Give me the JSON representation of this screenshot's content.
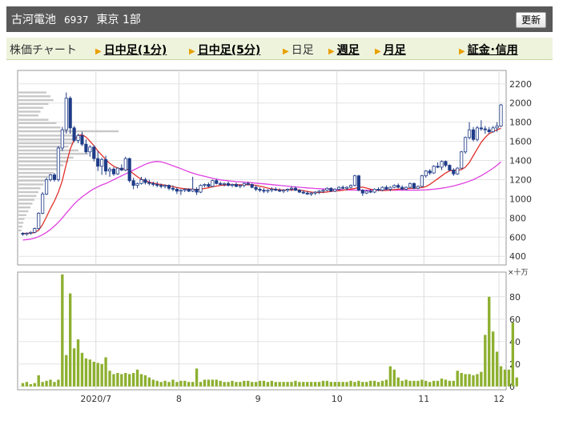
{
  "header": {
    "company": "古河電池",
    "code": "6937",
    "market": "東京 1部",
    "update_label": "更新"
  },
  "tabs": [
    {
      "label": "株価チャート",
      "kind": "static"
    },
    {
      "label": "日中足(1分)",
      "kind": "link"
    },
    {
      "label": "日中足(5分)",
      "kind": "link"
    },
    {
      "label": "日足",
      "kind": "plain"
    },
    {
      "label": "週足",
      "kind": "link"
    },
    {
      "label": "月足",
      "kind": "link"
    },
    {
      "label": "証金･信用",
      "kind": "link"
    }
  ],
  "chart_data": {
    "type": "candlestick",
    "period": "daily",
    "price_axis": {
      "ticks": [
        400,
        600,
        800,
        1000,
        1200,
        1400,
        1600,
        1800,
        2000,
        2200
      ],
      "range": [
        310,
        2340
      ]
    },
    "volume_axis": {
      "unit": "×十万",
      "ticks": [
        0,
        20,
        40,
        60,
        80
      ],
      "range": [
        -3,
        102
      ]
    },
    "x_labels": [
      {
        "label": "2020/7",
        "index": 19
      },
      {
        "label": "8",
        "index": 40
      },
      {
        "label": "9",
        "index": 60
      },
      {
        "label": "10",
        "index": 80
      },
      {
        "label": "11",
        "index": 102
      },
      {
        "label": "12",
        "index": 121
      }
    ],
    "colors": {
      "up": "#ffffff",
      "down": "#1f3c88",
      "ma_short": "#e0302a",
      "ma_long": "#e040e0",
      "volume": "#8db030",
      "profile": "#c8c8c8"
    },
    "volume_profile": [
      {
        "price": 1825,
        "value": 0.3
      },
      {
        "price": 1790,
        "value": 0.38
      },
      {
        "price": 1745,
        "value": 0.42
      },
      {
        "price": 1705,
        "value": 1.0
      },
      {
        "price": 1660,
        "value": 0.55
      },
      {
        "price": 1620,
        "value": 0.6
      },
      {
        "price": 1580,
        "value": 0.55
      },
      {
        "price": 1545,
        "value": 0.5
      },
      {
        "price": 1505,
        "value": 0.6
      },
      {
        "price": 1470,
        "value": 0.7
      },
      {
        "price": 1430,
        "value": 0.55
      },
      {
        "price": 1390,
        "value": 0.5
      },
      {
        "price": 1350,
        "value": 0.45
      },
      {
        "price": 1310,
        "value": 0.4
      },
      {
        "price": 1270,
        "value": 0.35
      },
      {
        "price": 1230,
        "value": 0.3
      },
      {
        "price": 1190,
        "value": 0.28
      },
      {
        "price": 1150,
        "value": 0.25
      },
      {
        "price": 1110,
        "value": 0.22
      },
      {
        "price": 1070,
        "value": 0.2
      },
      {
        "price": 1030,
        "value": 0.18
      },
      {
        "price": 990,
        "value": 0.16
      },
      {
        "price": 950,
        "value": 0.14
      },
      {
        "price": 910,
        "value": 0.12
      },
      {
        "price": 870,
        "value": 0.1
      },
      {
        "price": 830,
        "value": 0.08
      },
      {
        "price": 790,
        "value": 0.06
      },
      {
        "price": 750,
        "value": 0.05
      },
      {
        "price": 710,
        "value": 0.04
      },
      {
        "price": 670,
        "value": 0.03
      },
      {
        "price": 2110,
        "value": 0.28
      },
      {
        "price": 2070,
        "value": 0.32
      },
      {
        "price": 2030,
        "value": 0.35
      },
      {
        "price": 1990,
        "value": 0.3
      },
      {
        "price": 1950,
        "value": 0.25
      },
      {
        "price": 1910,
        "value": 0.22
      },
      {
        "price": 1870,
        "value": 0.2
      }
    ],
    "candles": [
      [
        640,
        650,
        615,
        630
      ],
      [
        630,
        650,
        615,
        640
      ],
      [
        640,
        660,
        625,
        650
      ],
      [
        650,
        700,
        640,
        690
      ],
      [
        690,
        860,
        680,
        850
      ],
      [
        850,
        1070,
        840,
        1050
      ],
      [
        1050,
        1220,
        1040,
        1200
      ],
      [
        1200,
        1260,
        1180,
        1250
      ],
      [
        1250,
        1270,
        1180,
        1200
      ],
      [
        1200,
        1550,
        1180,
        1530
      ],
      [
        1530,
        1750,
        1500,
        1720
      ],
      [
        1720,
        2110,
        1680,
        2050
      ],
      [
        2050,
        2070,
        1680,
        1740
      ],
      [
        1740,
        1760,
        1590,
        1610
      ],
      [
        1610,
        1680,
        1580,
        1660
      ],
      [
        1660,
        1700,
        1550,
        1570
      ],
      [
        1570,
        1620,
        1470,
        1490
      ],
      [
        1490,
        1560,
        1440,
        1540
      ],
      [
        1540,
        1560,
        1390,
        1420
      ],
      [
        1420,
        1500,
        1290,
        1340
      ],
      [
        1340,
        1430,
        1250,
        1410
      ],
      [
        1410,
        1450,
        1250,
        1290
      ],
      [
        1290,
        1330,
        1230,
        1310
      ],
      [
        1310,
        1330,
        1240,
        1260
      ],
      [
        1260,
        1330,
        1250,
        1320
      ],
      [
        1320,
        1360,
        1290,
        1300
      ],
      [
        1300,
        1440,
        1290,
        1420
      ],
      [
        1420,
        1430,
        1170,
        1190
      ],
      [
        1190,
        1220,
        1100,
        1140
      ],
      [
        1140,
        1170,
        1110,
        1160
      ],
      [
        1160,
        1230,
        1150,
        1200
      ],
      [
        1200,
        1220,
        1150,
        1170
      ],
      [
        1170,
        1200,
        1140,
        1160
      ],
      [
        1160,
        1180,
        1130,
        1150
      ],
      [
        1150,
        1180,
        1120,
        1140
      ],
      [
        1140,
        1160,
        1110,
        1130
      ],
      [
        1130,
        1150,
        1110,
        1140
      ],
      [
        1140,
        1150,
        1090,
        1110
      ],
      [
        1110,
        1140,
        1080,
        1100
      ],
      [
        1100,
        1120,
        1050,
        1080
      ],
      [
        1080,
        1100,
        1040,
        1090
      ],
      [
        1090,
        1110,
        1070,
        1100
      ],
      [
        1100,
        1110,
        1070,
        1080
      ],
      [
        1080,
        1230,
        1070,
        1100
      ],
      [
        1100,
        1120,
        1040,
        1070
      ],
      [
        1070,
        1150,
        1060,
        1140
      ],
      [
        1140,
        1160,
        1120,
        1150
      ],
      [
        1150,
        1170,
        1120,
        1130
      ],
      [
        1130,
        1200,
        1120,
        1190
      ],
      [
        1190,
        1210,
        1150,
        1160
      ],
      [
        1160,
        1180,
        1140,
        1150
      ],
      [
        1150,
        1170,
        1130,
        1160
      ],
      [
        1160,
        1180,
        1130,
        1140
      ],
      [
        1140,
        1160,
        1120,
        1150
      ],
      [
        1150,
        1170,
        1120,
        1130
      ],
      [
        1130,
        1150,
        1110,
        1140
      ],
      [
        1140,
        1170,
        1120,
        1160
      ],
      [
        1160,
        1180,
        1140,
        1150
      ],
      [
        1150,
        1160,
        1110,
        1120
      ],
      [
        1120,
        1140,
        1080,
        1100
      ],
      [
        1100,
        1120,
        1070,
        1090
      ],
      [
        1090,
        1110,
        1060,
        1080
      ],
      [
        1080,
        1100,
        1060,
        1090
      ],
      [
        1090,
        1120,
        1070,
        1100
      ],
      [
        1100,
        1120,
        1080,
        1090
      ],
      [
        1090,
        1110,
        1070,
        1080
      ],
      [
        1080,
        1100,
        1060,
        1090
      ],
      [
        1090,
        1110,
        1070,
        1100
      ],
      [
        1100,
        1130,
        1080,
        1110
      ],
      [
        1110,
        1130,
        1080,
        1090
      ],
      [
        1090,
        1100,
        1060,
        1070
      ],
      [
        1070,
        1090,
        1050,
        1060
      ],
      [
        1060,
        1080,
        1040,
        1050
      ],
      [
        1050,
        1070,
        1030,
        1060
      ],
      [
        1060,
        1080,
        1040,
        1070
      ],
      [
        1070,
        1090,
        1050,
        1080
      ],
      [
        1080,
        1100,
        1060,
        1090
      ],
      [
        1090,
        1120,
        1080,
        1110
      ],
      [
        1110,
        1120,
        1070,
        1080
      ],
      [
        1080,
        1110,
        1070,
        1100
      ],
      [
        1100,
        1130,
        1090,
        1120
      ],
      [
        1120,
        1140,
        1100,
        1110
      ],
      [
        1110,
        1130,
        1090,
        1120
      ],
      [
        1120,
        1150,
        1110,
        1140
      ],
      [
        1140,
        1250,
        1130,
        1240
      ],
      [
        1240,
        1250,
        1080,
        1090
      ],
      [
        1090,
        1100,
        1030,
        1060
      ],
      [
        1060,
        1090,
        1050,
        1080
      ],
      [
        1080,
        1100,
        1060,
        1070
      ],
      [
        1070,
        1110,
        1060,
        1100
      ],
      [
        1100,
        1120,
        1080,
        1090
      ],
      [
        1090,
        1130,
        1080,
        1120
      ],
      [
        1120,
        1140,
        1090,
        1100
      ],
      [
        1100,
        1130,
        1080,
        1120
      ],
      [
        1120,
        1150,
        1110,
        1140
      ],
      [
        1140,
        1160,
        1110,
        1120
      ],
      [
        1120,
        1140,
        1090,
        1100
      ],
      [
        1100,
        1130,
        1090,
        1120
      ],
      [
        1120,
        1170,
        1110,
        1160
      ],
      [
        1160,
        1170,
        1100,
        1110
      ],
      [
        1110,
        1140,
        1100,
        1130
      ],
      [
        1130,
        1250,
        1120,
        1240
      ],
      [
        1240,
        1300,
        1220,
        1290
      ],
      [
        1290,
        1310,
        1250,
        1270
      ],
      [
        1270,
        1350,
        1260,
        1340
      ],
      [
        1340,
        1380,
        1320,
        1330
      ],
      [
        1330,
        1400,
        1300,
        1390
      ],
      [
        1390,
        1400,
        1330,
        1350
      ],
      [
        1350,
        1360,
        1290,
        1300
      ],
      [
        1300,
        1320,
        1240,
        1260
      ],
      [
        1260,
        1330,
        1250,
        1320
      ],
      [
        1320,
        1500,
        1310,
        1490
      ],
      [
        1490,
        1650,
        1470,
        1640
      ],
      [
        1640,
        1800,
        1620,
        1720
      ],
      [
        1720,
        1750,
        1600,
        1620
      ],
      [
        1620,
        1760,
        1600,
        1740
      ],
      [
        1740,
        1820,
        1710,
        1730
      ],
      [
        1730,
        1760,
        1680,
        1720
      ],
      [
        1720,
        1750,
        1680,
        1700
      ],
      [
        1700,
        1760,
        1690,
        1740
      ],
      [
        1740,
        1800,
        1700,
        1760
      ],
      [
        1760,
        1990,
        1750,
        1980
      ]
    ],
    "ma_short": [
      640,
      640,
      642,
      648,
      672,
      730,
      812,
      900,
      975,
      1070,
      1190,
      1360,
      1520,
      1620,
      1660,
      1670,
      1645,
      1600,
      1555,
      1500,
      1455,
      1410,
      1370,
      1340,
      1320,
      1312,
      1315,
      1295,
      1262,
      1230,
      1205,
      1188,
      1175,
      1165,
      1155,
      1148,
      1142,
      1135,
      1128,
      1118,
      1110,
      1105,
      1102,
      1100,
      1097,
      1100,
      1108,
      1115,
      1125,
      1133,
      1140,
      1143,
      1146,
      1148,
      1148,
      1146,
      1146,
      1148,
      1146,
      1140,
      1132,
      1122,
      1112,
      1104,
      1098,
      1094,
      1092,
      1092,
      1094,
      1095,
      1092,
      1086,
      1078,
      1070,
      1066,
      1066,
      1068,
      1072,
      1078,
      1082,
      1084,
      1090,
      1096,
      1102,
      1108,
      1120,
      1122,
      1112,
      1100,
      1092,
      1088,
      1086,
      1088,
      1092,
      1096,
      1100,
      1104,
      1106,
      1108,
      1110,
      1112,
      1118,
      1128,
      1150,
      1180,
      1210,
      1240,
      1270,
      1292,
      1300,
      1298,
      1305,
      1330,
      1380,
      1450,
      1520,
      1590,
      1640,
      1680,
      1700,
      1720,
      1735
    ],
    "ma_long": [
      570,
      575,
      580,
      590,
      605,
      625,
      650,
      680,
      715,
      755,
      800,
      850,
      900,
      945,
      985,
      1020,
      1050,
      1080,
      1105,
      1125,
      1145,
      1160,
      1180,
      1200,
      1220,
      1240,
      1260,
      1280,
      1300,
      1320,
      1340,
      1360,
      1375,
      1385,
      1390,
      1385,
      1375,
      1360,
      1345,
      1330,
      1315,
      1298,
      1282,
      1268,
      1255,
      1245,
      1235,
      1225,
      1215,
      1205,
      1198,
      1192,
      1188,
      1184,
      1180,
      1178,
      1175,
      1172,
      1168,
      1164,
      1160,
      1156,
      1152,
      1148,
      1144,
      1140,
      1136,
      1132,
      1128,
      1124,
      1120,
      1117,
      1114,
      1111,
      1108,
      1106,
      1104,
      1102,
      1100,
      1098,
      1096,
      1094,
      1093,
      1092,
      1091,
      1090,
      1090,
      1090,
      1090,
      1090,
      1090,
      1090,
      1090,
      1090,
      1090,
      1090,
      1090,
      1090,
      1090,
      1090,
      1090,
      1092,
      1094,
      1097,
      1100,
      1105,
      1110,
      1117,
      1125,
      1134,
      1145,
      1157,
      1170,
      1185,
      1200,
      1220,
      1242,
      1266,
      1292,
      1320,
      1350,
      1385
    ],
    "volume": [
      3,
      4,
      2,
      3,
      10,
      4,
      5,
      6,
      4,
      6,
      100,
      28,
      83,
      34,
      42,
      30,
      25,
      24,
      22,
      21,
      20,
      26,
      14,
      11,
      12,
      11,
      12,
      11,
      12,
      15,
      11,
      10,
      8,
      6,
      5,
      4,
      5,
      4,
      6,
      4,
      5,
      5,
      4,
      4,
      16,
      4,
      6,
      6,
      6,
      6,
      5,
      4,
      4,
      5,
      4,
      4,
      5,
      5,
      4,
      4,
      5,
      5,
      4,
      5,
      4,
      4,
      4,
      4,
      4,
      5,
      4,
      4,
      4,
      4,
      4,
      4,
      5,
      5,
      4,
      4,
      4,
      4,
      4,
      5,
      4,
      5,
      4,
      4,
      5,
      5,
      4,
      5,
      6,
      18,
      15,
      8,
      5,
      6,
      5,
      5,
      5,
      6,
      5,
      4,
      5,
      5,
      7,
      6,
      5,
      5,
      14,
      12,
      11,
      11,
      10,
      11,
      13,
      46,
      80,
      49,
      31,
      18,
      15,
      15,
      57,
      8
    ]
  }
}
